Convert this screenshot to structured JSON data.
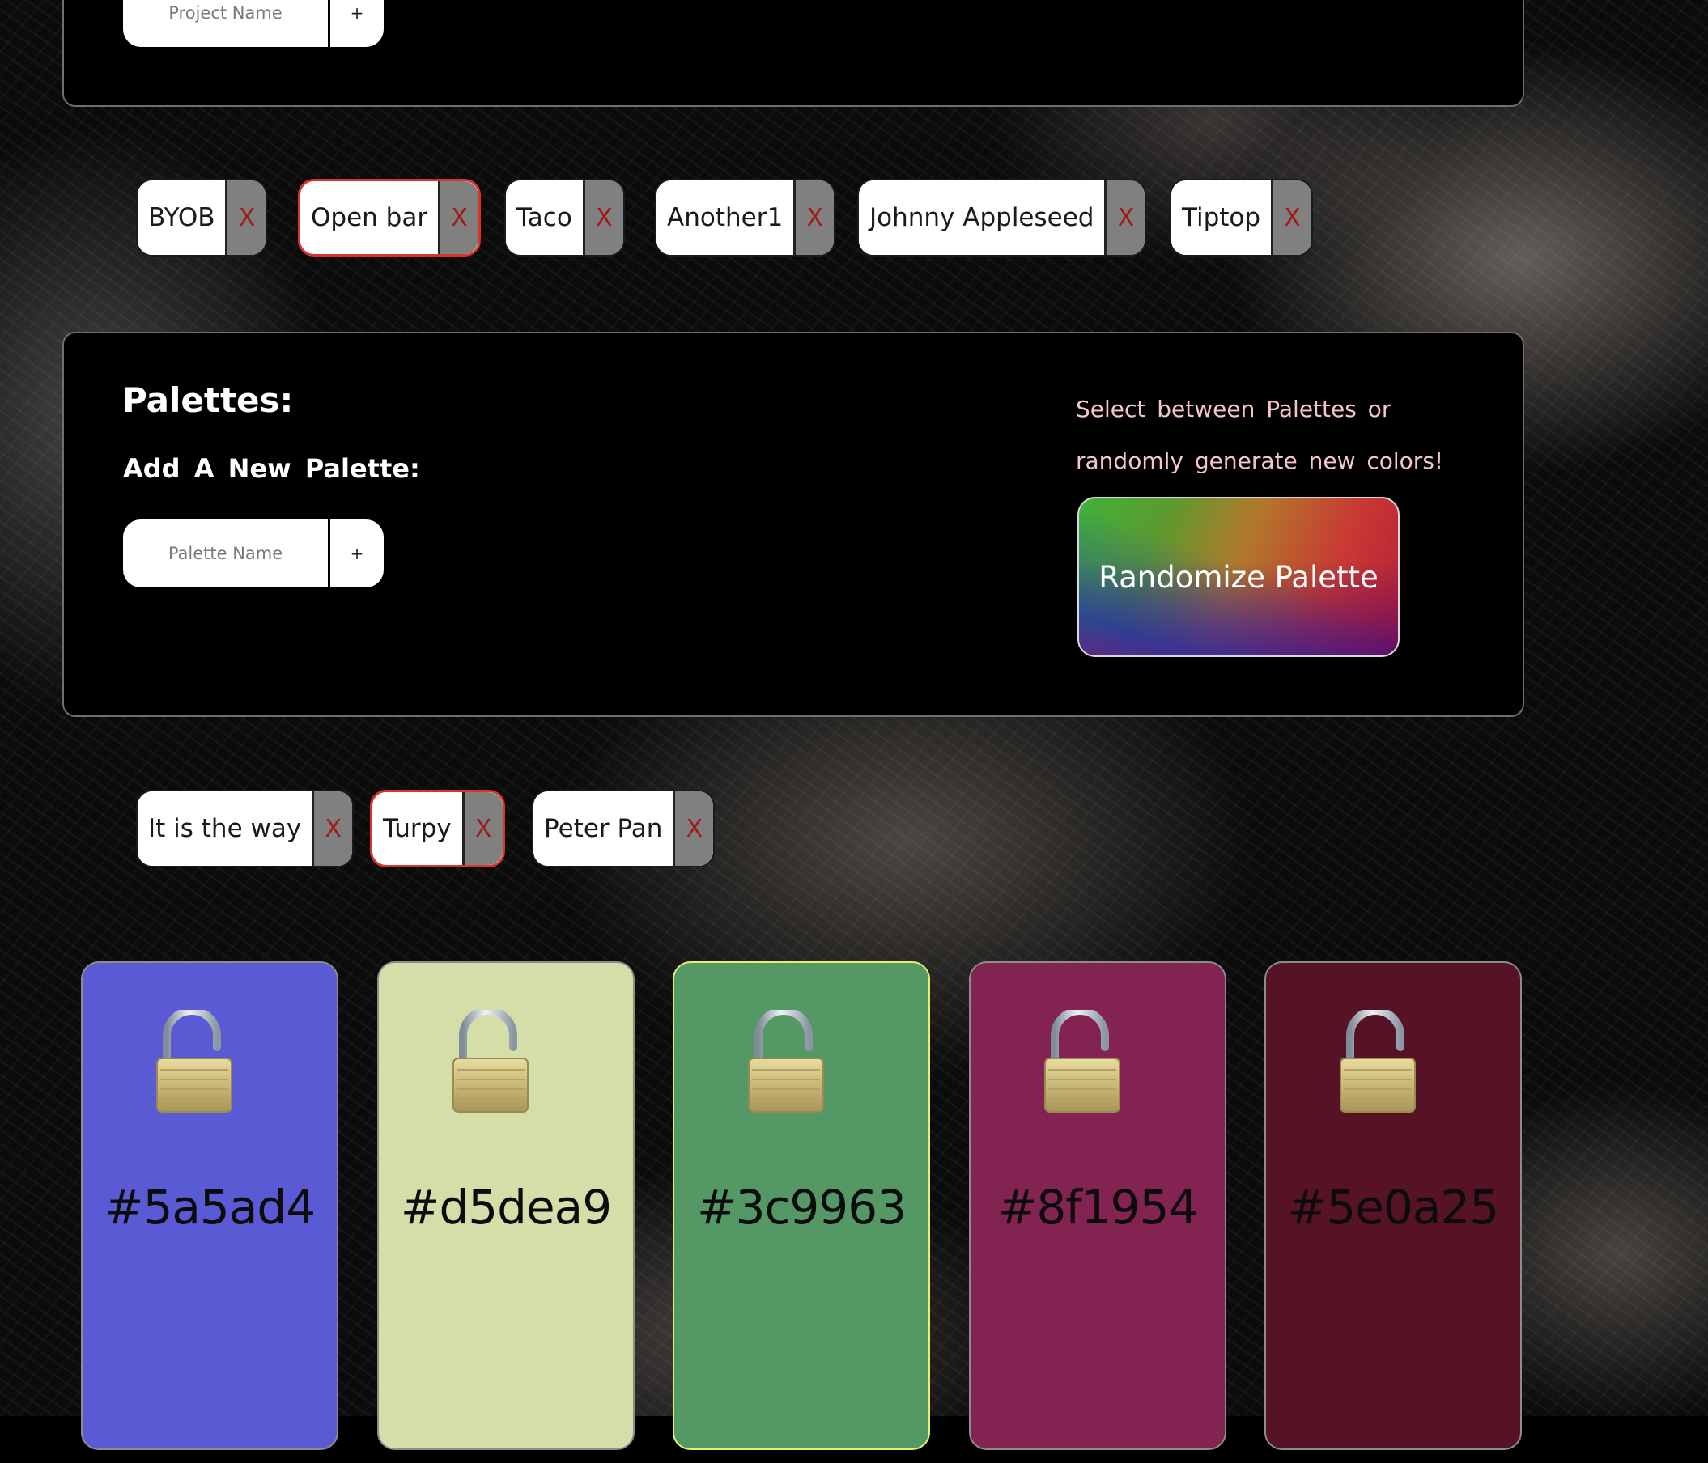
{
  "projects": {
    "input_placeholder": "Project Name",
    "add_label": "+",
    "chips": [
      {
        "name": "BYOB",
        "remove_label": "X",
        "selected": false
      },
      {
        "name": "Open bar",
        "remove_label": "X",
        "selected": true
      },
      {
        "name": "Taco",
        "remove_label": "X",
        "selected": false
      },
      {
        "name": "Another1",
        "remove_label": "X",
        "selected": false
      },
      {
        "name": "Johnny Appleseed",
        "remove_label": "X",
        "selected": false
      },
      {
        "name": "Tiptop",
        "remove_label": "X",
        "selected": false
      }
    ]
  },
  "palettes": {
    "title": "Palettes:",
    "subtitle": "Add A New Palette:",
    "input_placeholder": "Palette Name",
    "add_label": "+",
    "helper_text": "Select between Palettes or randomly generate new colors!",
    "randomize_label": "Randomize Palette",
    "chips": [
      {
        "name": "It is the way",
        "remove_label": "X",
        "selected": false
      },
      {
        "name": "Turpy",
        "remove_label": "X",
        "selected": true
      },
      {
        "name": "Peter Pan",
        "remove_label": "X",
        "selected": false
      }
    ]
  },
  "swatches": [
    {
      "hex": "#5a5ad4",
      "color": "#5a5ad4",
      "lock_icon": "open-padlock-icon",
      "locked": false
    },
    {
      "hex": "#d5dea9",
      "color": "#d5dea9",
      "lock_icon": "open-padlock-icon",
      "locked": false
    },
    {
      "hex": "#3c9963",
      "color": "#549965",
      "lock_icon": "open-padlock-icon",
      "locked": false
    },
    {
      "hex": "#8f1954",
      "color": "#822352",
      "lock_icon": "open-padlock-icon",
      "locked": false
    },
    {
      "hex": "#5e0a25",
      "color": "#561326",
      "lock_icon": "open-padlock-icon",
      "locked": false
    }
  ],
  "colors": {
    "chip_selected_border": "#d8342b",
    "remove_x": "#a11a1a",
    "helper_text": "#f4c6cc"
  }
}
